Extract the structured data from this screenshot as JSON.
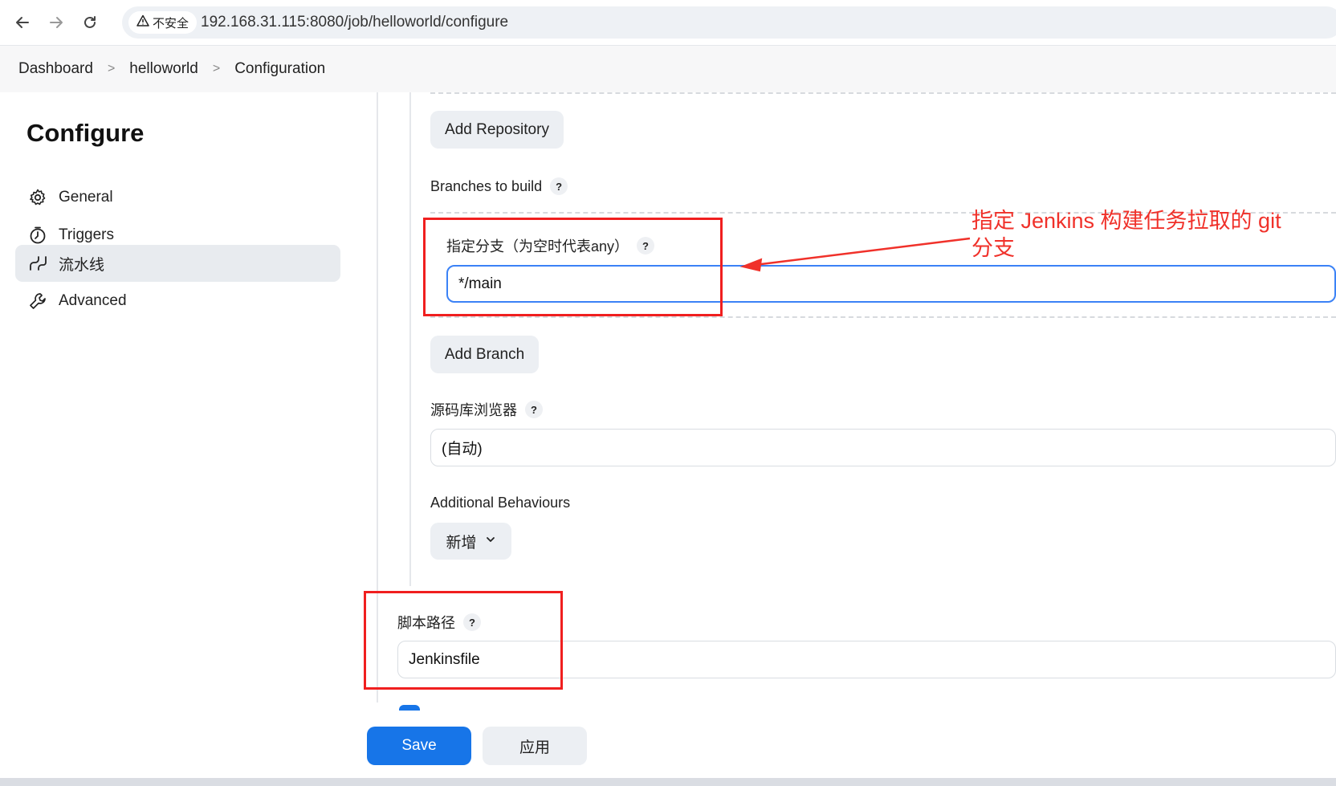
{
  "browser": {
    "insecure_label": "不安全",
    "url": "192.168.31.115:8080/job/helloworld/configure"
  },
  "breadcrumb": [
    "Dashboard",
    "helloworld",
    "Configuration"
  ],
  "sidebar": {
    "title": "Configure",
    "items": [
      {
        "label": "General",
        "icon": "gear-icon"
      },
      {
        "label": "Triggers",
        "icon": "clock-icon"
      },
      {
        "label": "流水线",
        "icon": "pipeline-icon"
      },
      {
        "label": "Advanced",
        "icon": "wrench-icon"
      }
    ]
  },
  "main": {
    "add_repository": "Add Repository",
    "branches_label": "Branches to build",
    "branch_spec_label": "指定分支（为空时代表any）",
    "branch_spec_value": "*/main",
    "add_branch": "Add Branch",
    "repo_browser_label": "源码库浏览器",
    "repo_browser_value": "(自动)",
    "additional_behaviours_label": "Additional Behaviours",
    "add_dropdown": "新增",
    "script_path_label": "脚本路径",
    "script_path_value": "Jenkinsfile",
    "help": "?"
  },
  "annotation": {
    "text": "指定 Jenkins 构建任务拉取的 git 分支",
    "color": "#f0312a"
  },
  "footer": {
    "save": "Save",
    "apply": "应用"
  }
}
